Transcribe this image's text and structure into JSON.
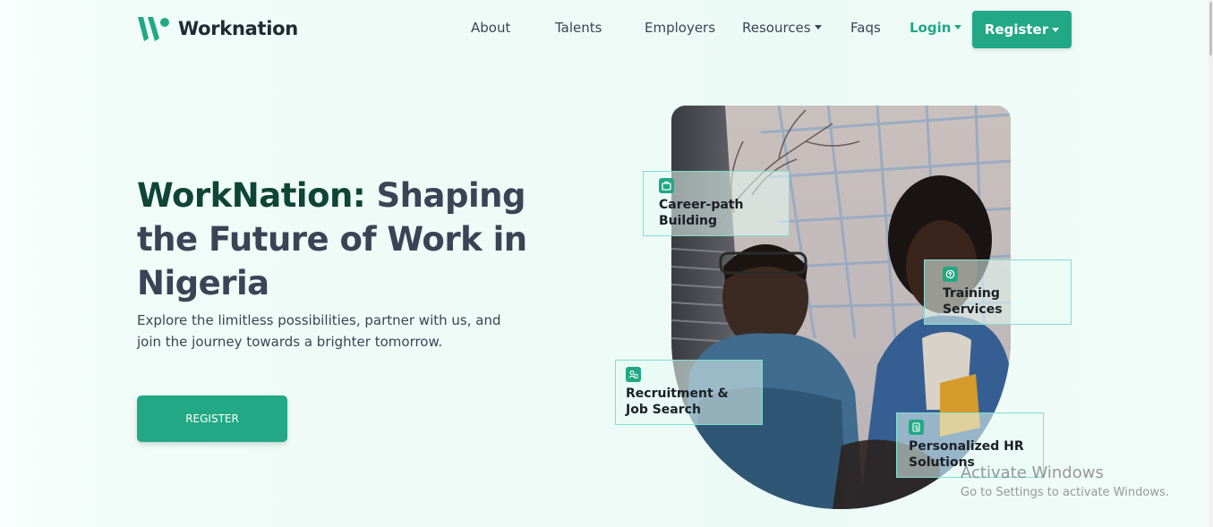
{
  "brand": {
    "name": "Worknation",
    "color": "#22a884",
    "dark_green": "#0f4534"
  },
  "nav": {
    "about": "About",
    "talents": "Talents",
    "employers": "Employers",
    "resources": "Resources",
    "faqs": "Faqs",
    "login": "Login",
    "register": "Register"
  },
  "hero": {
    "title_accent": "WorkNation:",
    "title_rest": "Shaping the Future of Work in Nigeria",
    "subtitle": "Explore the limitless possibilities, partner with us, and join the journey towards a brighter tomorrow.",
    "cta": "REGISTER"
  },
  "features": [
    {
      "label": "Career-path Building",
      "icon": "briefcase-icon"
    },
    {
      "label": "Training Services",
      "icon": "training-icon"
    },
    {
      "label": "Recruitment & Job Search",
      "icon": "recruitment-icon"
    },
    {
      "label": "Personalized HR Solutions",
      "icon": "document-icon"
    }
  ],
  "watermark": {
    "title": "Activate Windows",
    "subtitle": "Go to Settings to activate Windows."
  }
}
